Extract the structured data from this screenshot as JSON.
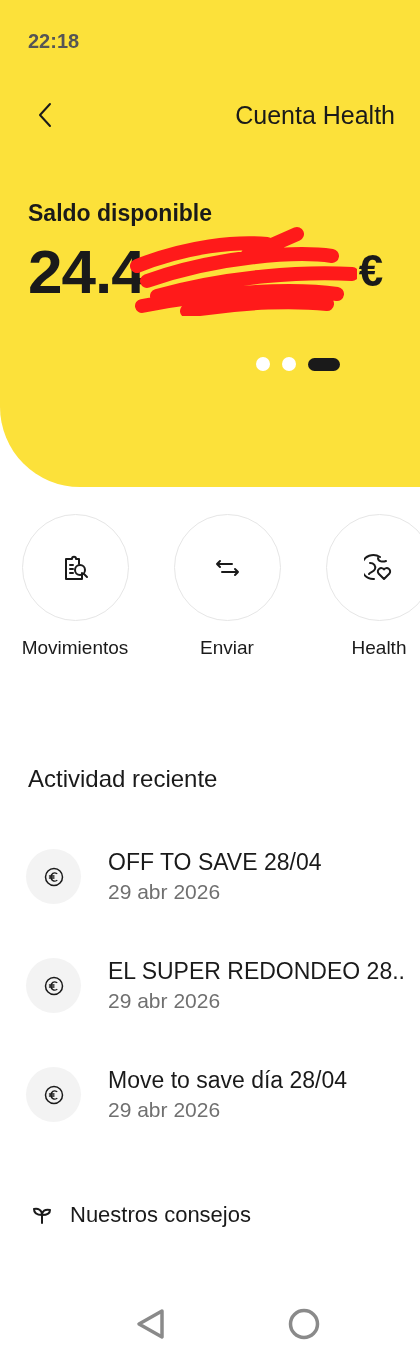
{
  "status_bar": {
    "time": "22:18"
  },
  "header": {
    "title": "Cuenta Health"
  },
  "balance": {
    "label": "Saldo disponible",
    "amount_visible": "24.4",
    "currency": "€",
    "redacted": true,
    "pager": [
      {
        "selected": false
      },
      {
        "selected": false
      },
      {
        "selected": true
      }
    ]
  },
  "actions": [
    {
      "kind": "movements",
      "label": "Movimientos"
    },
    {
      "kind": "send",
      "label": "Enviar"
    },
    {
      "kind": "health",
      "label": "Health"
    }
  ],
  "recent_activity": {
    "title": "Actividad reciente",
    "items": [
      {
        "title": "OFF TO SAVE 28/04",
        "date": "29 abr 2026"
      },
      {
        "title": "EL SUPER REDONDEO 28..",
        "date": "29 abr 2026"
      },
      {
        "title": "Move to save día 28/04",
        "date": "29 abr 2026"
      }
    ]
  },
  "tips": {
    "title": "Nuestros consejos"
  }
}
